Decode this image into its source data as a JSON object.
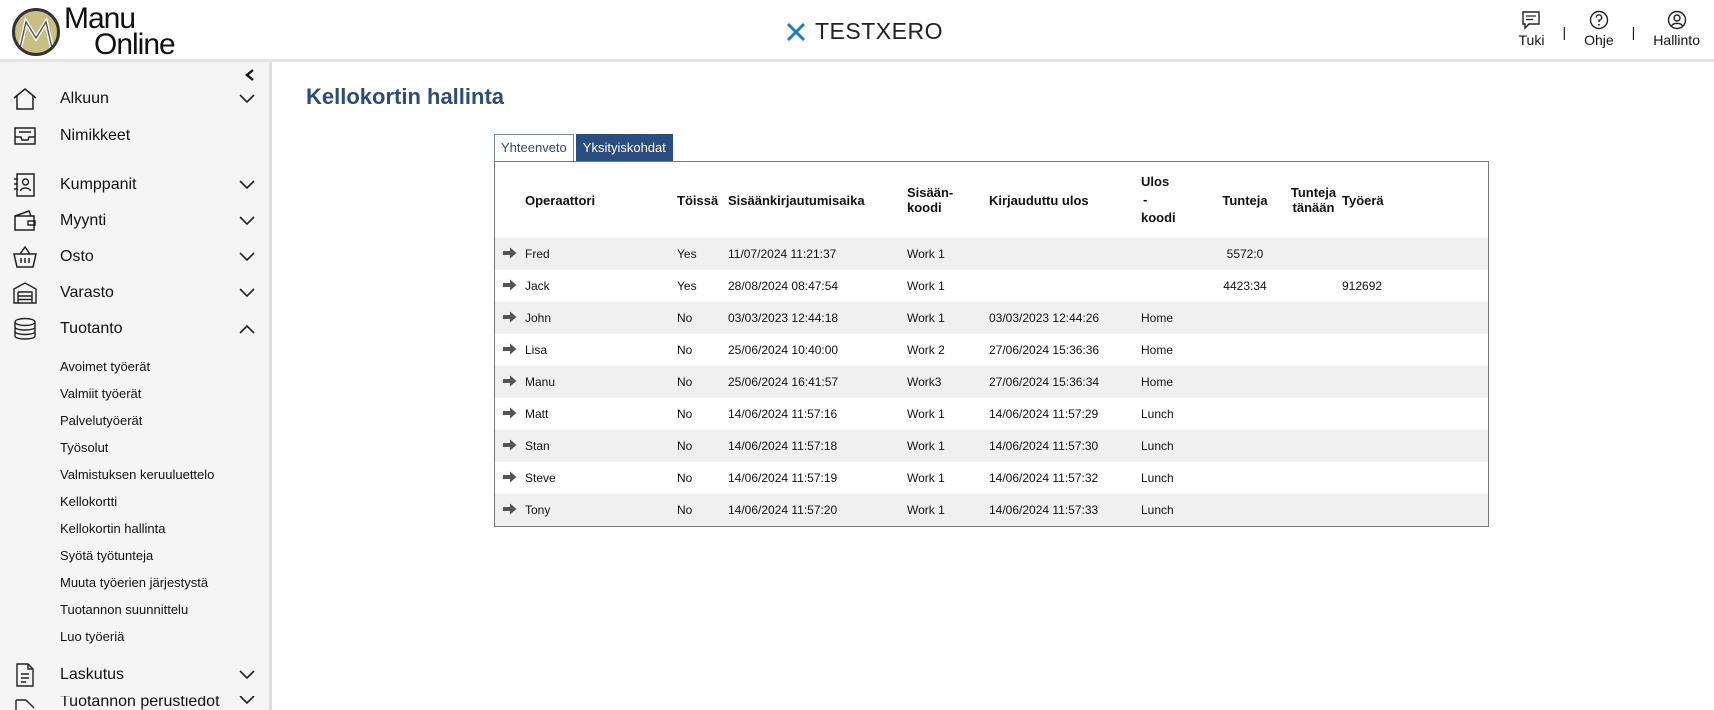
{
  "header": {
    "logo_line1": "Manu",
    "logo_line2": "Online",
    "brand": "TESTXERO",
    "actions": [
      {
        "label": "Tuki",
        "icon": "chat-icon"
      },
      {
        "label": "Ohje",
        "icon": "help-icon"
      },
      {
        "label": "Hallinto",
        "icon": "user-icon"
      }
    ],
    "separator": "|"
  },
  "sidebar": {
    "items": [
      {
        "label": "Alkuun",
        "icon": "home-icon",
        "chevron": "down"
      },
      {
        "label": "Nimikkeet",
        "icon": "inbox-icon",
        "chevron": "none"
      },
      {
        "label": "Kumppanit",
        "icon": "contacts-icon",
        "chevron": "down"
      },
      {
        "label": "Myynti",
        "icon": "wallet-icon",
        "chevron": "down"
      },
      {
        "label": "Osto",
        "icon": "basket-icon",
        "chevron": "down"
      },
      {
        "label": "Varasto",
        "icon": "warehouse-icon",
        "chevron": "down"
      },
      {
        "label": "Tuotanto",
        "icon": "database-icon",
        "chevron": "up"
      },
      {
        "label": "Laskutus",
        "icon": "document-icon",
        "chevron": "down"
      },
      {
        "label": "Tuotannon perustiedot",
        "icon": "settings-icon",
        "chevron": "down"
      }
    ],
    "sub_items": [
      "Avoimet työerät",
      "Valmiit työerät",
      "Palvelutyöerät",
      "Työsolut",
      "Valmistuksen keruuluettelo",
      "Kellokortti",
      "Kellokortin hallinta",
      "Syötä työtunteja",
      "Muuta työerien järjestystä",
      "Tuotannon suunnittelu",
      "Luo työeriä"
    ]
  },
  "main": {
    "title": "Kellokortin hallinta",
    "tabs": [
      {
        "label": "Yhteenveto",
        "active": true
      },
      {
        "label": "Yksityiskohdat",
        "active": false
      }
    ],
    "table": {
      "headers": {
        "operaattori": "Operaattori",
        "toissa": "Töissä",
        "sisaan_aika": "Sisäänkirjautumisaika",
        "sisaan_koodi_1": "Sisään-",
        "sisaan_koodi_2": "koodi",
        "ulos": "Kirjauduttu ulos",
        "ulos_koodi_1": "Ulos",
        "ulos_koodi_2": "-",
        "ulos_koodi_3": "koodi",
        "tunteja": "Tunteja",
        "tanaan_1": "Tunteja",
        "tanaan_2": "tänään",
        "tyoera": "Työerä"
      },
      "rows": [
        {
          "op": "Fred",
          "toissa": "Yes",
          "in_time": "11/07/2024 11:21:37",
          "in_code": "Work 1",
          "out_time": "",
          "out_code": "",
          "hours": "5572:0",
          "today": "",
          "job": ""
        },
        {
          "op": "Jack",
          "toissa": "Yes",
          "in_time": "28/08/2024 08:47:54",
          "in_code": "Work 1",
          "out_time": "",
          "out_code": "",
          "hours": "4423:34",
          "today": "",
          "job": "912692"
        },
        {
          "op": "John",
          "toissa": "No",
          "in_time": "03/03/2023 12:44:18",
          "in_code": "Work 1",
          "out_time": "03/03/2023 12:44:26",
          "out_code": "Home",
          "hours": "",
          "today": "",
          "job": ""
        },
        {
          "op": "Lisa",
          "toissa": "No",
          "in_time": "25/06/2024 10:40:00",
          "in_code": "Work 2",
          "out_time": "27/06/2024 15:36:36",
          "out_code": "Home",
          "hours": "",
          "today": "",
          "job": ""
        },
        {
          "op": "Manu",
          "toissa": "No",
          "in_time": "25/06/2024 16:41:57",
          "in_code": "Work3",
          "out_time": "27/06/2024 15:36:34",
          "out_code": "Home",
          "hours": "",
          "today": "",
          "job": ""
        },
        {
          "op": "Matt",
          "toissa": "No",
          "in_time": "14/06/2024 11:57:16",
          "in_code": "Work 1",
          "out_time": "14/06/2024 11:57:29",
          "out_code": "Lunch",
          "hours": "",
          "today": "",
          "job": ""
        },
        {
          "op": "Stan",
          "toissa": "No",
          "in_time": "14/06/2024 11:57:18",
          "in_code": "Work 1",
          "out_time": "14/06/2024 11:57:30",
          "out_code": "Lunch",
          "hours": "",
          "today": "",
          "job": ""
        },
        {
          "op": "Steve",
          "toissa": "No",
          "in_time": "14/06/2024 11:57:19",
          "in_code": "Work 1",
          "out_time": "14/06/2024 11:57:32",
          "out_code": "Lunch",
          "hours": "",
          "today": "",
          "job": ""
        },
        {
          "op": "Tony",
          "toissa": "No",
          "in_time": "14/06/2024 11:57:20",
          "in_code": "Work 1",
          "out_time": "14/06/2024 11:57:33",
          "out_code": "Lunch",
          "hours": "",
          "today": "",
          "job": ""
        }
      ]
    }
  },
  "colors": {
    "accent": "#2b4c7e",
    "brand_icon": "#1f7bc1",
    "row_alt": "#f0f0f0"
  }
}
